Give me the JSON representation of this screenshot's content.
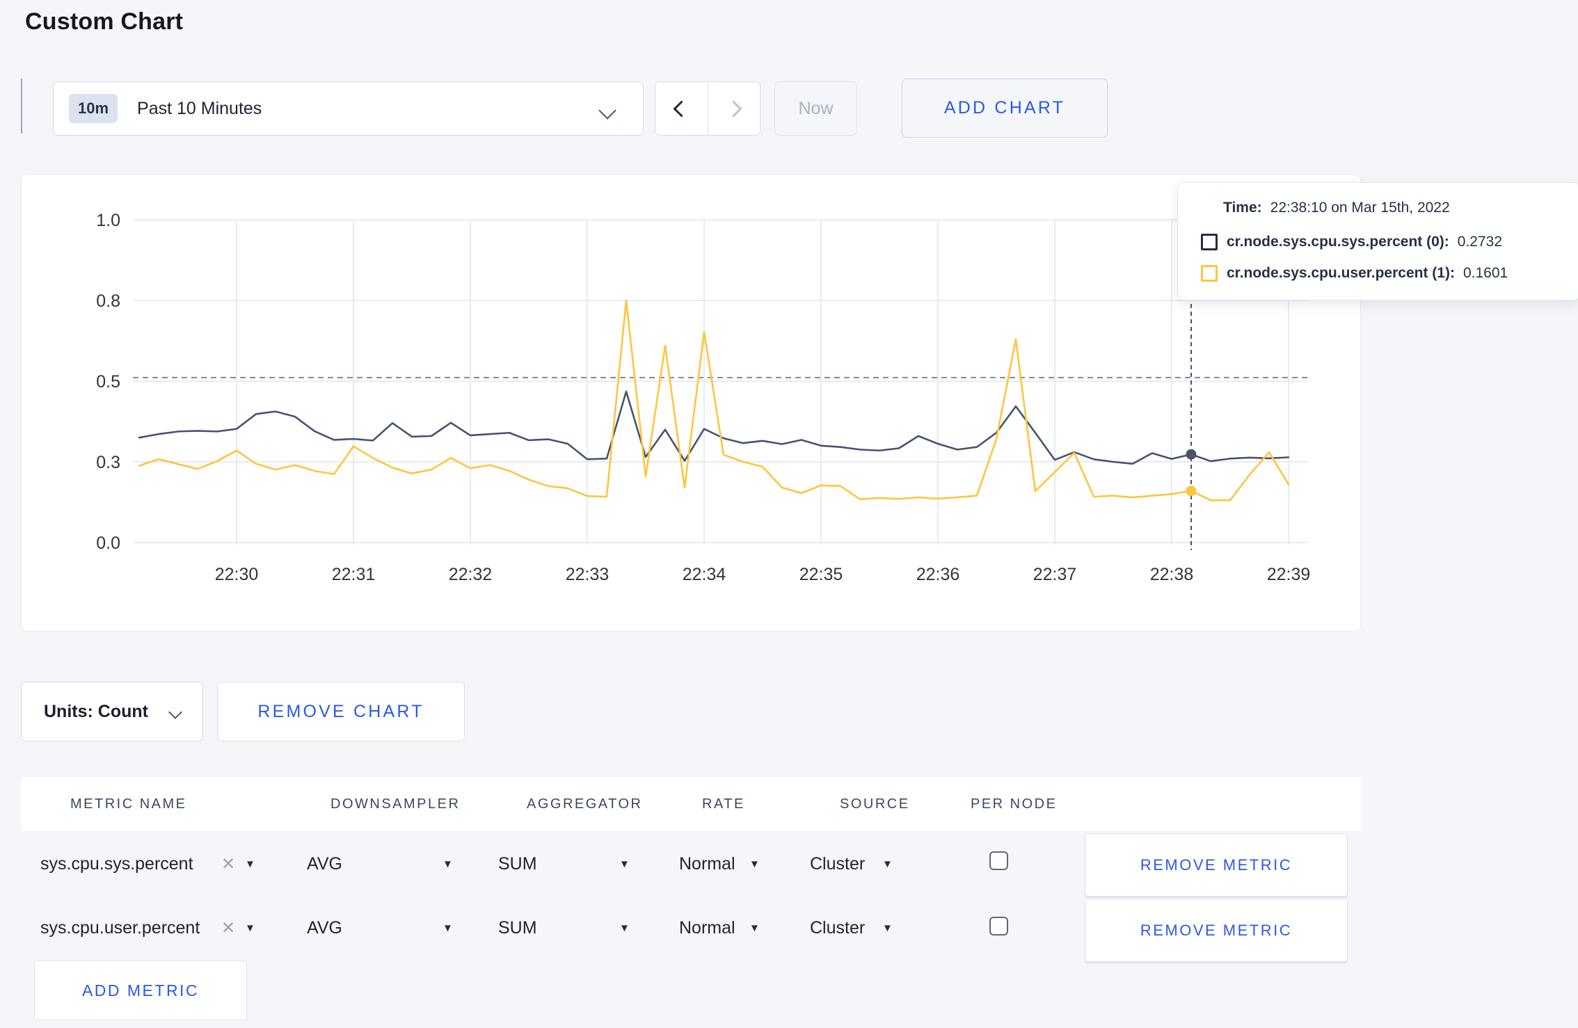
{
  "page": {
    "title": "Custom Chart"
  },
  "toolbar": {
    "time_badge": "10m",
    "time_label": "Past 10 Minutes",
    "now_label": "Now",
    "add_chart_label": "ADD CHART"
  },
  "chart_data": {
    "type": "line",
    "x": [
      "22:29:10",
      "22:29:20",
      "22:29:30",
      "22:29:40",
      "22:29:50",
      "22:30:00",
      "22:30:10",
      "22:30:20",
      "22:30:30",
      "22:30:40",
      "22:30:50",
      "22:31:00",
      "22:31:10",
      "22:31:20",
      "22:31:30",
      "22:31:40",
      "22:31:50",
      "22:32:00",
      "22:32:10",
      "22:32:20",
      "22:32:30",
      "22:32:40",
      "22:32:50",
      "22:33:00",
      "22:33:10",
      "22:33:20",
      "22:33:30",
      "22:33:40",
      "22:33:50",
      "22:34:00",
      "22:34:10",
      "22:34:20",
      "22:34:30",
      "22:34:40",
      "22:34:50",
      "22:35:00",
      "22:35:10",
      "22:35:20",
      "22:35:30",
      "22:35:40",
      "22:35:50",
      "22:36:00",
      "22:36:10",
      "22:36:20",
      "22:36:30",
      "22:36:40",
      "22:36:50",
      "22:37:00",
      "22:37:10",
      "22:37:20",
      "22:37:30",
      "22:37:40",
      "22:37:50",
      "22:38:00",
      "22:38:10",
      "22:38:20",
      "22:38:30",
      "22:38:40",
      "22:38:50",
      "22:39:00"
    ],
    "series": [
      {
        "name": "cr.node.sys.cpu.sys.percent",
        "color": "#46546e",
        "values": [
          0.325,
          0.336,
          0.344,
          0.346,
          0.344,
          0.352,
          0.398,
          0.406,
          0.39,
          0.345,
          0.318,
          0.321,
          0.316,
          0.37,
          0.328,
          0.33,
          0.371,
          0.332,
          0.336,
          0.34,
          0.317,
          0.32,
          0.306,
          0.258,
          0.26,
          0.468,
          0.265,
          0.35,
          0.253,
          0.352,
          0.323,
          0.308,
          0.315,
          0.305,
          0.318,
          0.3,
          0.296,
          0.288,
          0.285,
          0.292,
          0.33,
          0.306,
          0.288,
          0.296,
          0.34,
          0.422,
          0.34,
          0.256,
          0.28,
          0.258,
          0.25,
          0.244,
          0.277,
          0.259,
          0.2732,
          0.252,
          0.26,
          0.263,
          0.261,
          0.264
        ]
      },
      {
        "name": "cr.node.sys.cpu.user.percent",
        "color": "#ffc53d",
        "values": [
          0.238,
          0.258,
          0.243,
          0.228,
          0.252,
          0.285,
          0.244,
          0.226,
          0.24,
          0.222,
          0.212,
          0.298,
          0.262,
          0.232,
          0.214,
          0.226,
          0.262,
          0.23,
          0.24,
          0.222,
          0.195,
          0.175,
          0.168,
          0.144,
          0.142,
          0.75,
          0.205,
          0.61,
          0.17,
          0.652,
          0.272,
          0.25,
          0.235,
          0.17,
          0.153,
          0.177,
          0.175,
          0.134,
          0.138,
          0.135,
          0.14,
          0.136,
          0.14,
          0.145,
          0.32,
          0.63,
          0.159,
          0.218,
          0.278,
          0.142,
          0.145,
          0.14,
          0.145,
          0.15,
          0.1601,
          0.131,
          0.131,
          0.21,
          0.28,
          0.18
        ]
      }
    ],
    "ylim": [
      0,
      1
    ],
    "yticks": [
      {
        "v": 0.0,
        "label": "0.0"
      },
      {
        "v": 0.25,
        "label": "0.3"
      },
      {
        "v": 0.5,
        "label": "0.5"
      },
      {
        "v": 0.75,
        "label": "0.8"
      },
      {
        "v": 1.0,
        "label": "1.0"
      }
    ],
    "xtick_labels": [
      "22:30",
      "22:31",
      "22:32",
      "22:33",
      "22:34",
      "22:35",
      "22:36",
      "22:37",
      "22:38",
      "22:39"
    ],
    "grid": true,
    "legend_position": "tooltip",
    "crosshair": {
      "index": 54,
      "time": "22:38:10",
      "hline_value": 0.511,
      "values": [
        0.2732,
        0.1601
      ]
    }
  },
  "tooltip": {
    "time_label": "Time:",
    "time_value": "22:38:10 on Mar 15th, 2022",
    "rows": [
      {
        "label": "cr.node.sys.cpu.sys.percent (0):",
        "value": "0.2732",
        "color": "#242f42"
      },
      {
        "label": "cr.node.sys.cpu.user.percent (1):",
        "value": "0.1601",
        "color": "#ffc53d"
      }
    ]
  },
  "chart_footer": {
    "units_label": "Units: Count",
    "remove_chart_label": "REMOVE CHART"
  },
  "metrics_table": {
    "headers": [
      "METRIC NAME",
      "DOWNSAMPLER",
      "AGGREGATOR",
      "RATE",
      "SOURCE",
      "PER NODE"
    ],
    "icons": {
      "clear": "✕",
      "dropdown": "▼"
    },
    "rows": [
      {
        "metric": "sys.cpu.sys.percent",
        "downsampler": "AVG",
        "aggregator": "SUM",
        "rate": "Normal",
        "source": "Cluster",
        "per_node_checked": false,
        "remove_label": "REMOVE METRIC"
      },
      {
        "metric": "sys.cpu.user.percent",
        "downsampler": "AVG",
        "aggregator": "SUM",
        "rate": "Normal",
        "source": "Cluster",
        "per_node_checked": false,
        "remove_label": "REMOVE METRIC"
      }
    ],
    "add_metric_label": "ADD METRIC"
  },
  "colors": {
    "accent_blue": "#2b59e5",
    "series_sys": "#46546e",
    "series_user": "#ffc53d",
    "page_bg": "#f4f6fa",
    "grid_line": "#e9ebef"
  }
}
